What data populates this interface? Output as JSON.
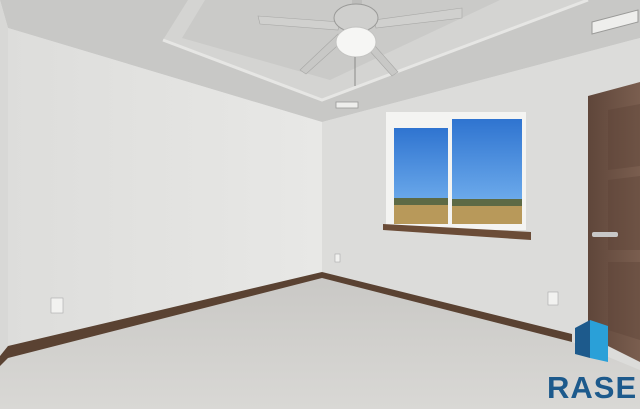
{
  "photo": {
    "subject": "empty-bedroom-interior",
    "colors": {
      "ceiling": "#c9c9c7",
      "tray_ceiling": "#d6d6d4",
      "left_wall": "#e4e4e2",
      "back_wall": "#dcdcda",
      "right_wall": "#e2e2e0",
      "carpet": "#d3d2cf",
      "baseboard": "#5a4232",
      "door": "#6e5446",
      "window_frame": "#f4f4f2",
      "window_sill": "#6b4c37",
      "sky": "#3b82d8",
      "field": "#b8995a",
      "fan_metal": "#d8d8d6"
    }
  },
  "watermark": {
    "brand": "RASE",
    "brand_color": "#1d5a8c",
    "mark_color": "#2aa0d8"
  }
}
